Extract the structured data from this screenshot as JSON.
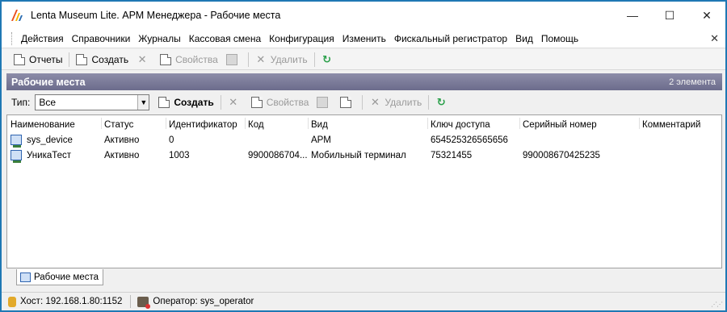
{
  "window": {
    "title": "Lenta Museum Lite. АРМ Менеджера - Рабочие места",
    "minimize": "—",
    "maximize": "☐",
    "close": "✕"
  },
  "menu": {
    "items": [
      "Действия",
      "Справочники",
      "Журналы",
      "Кассовая смена",
      "Конфигурация",
      "Изменить",
      "Фискальный регистратор",
      "Вид",
      "Помощь"
    ],
    "close": "✕"
  },
  "main_toolbar": {
    "reports": "Отчеты",
    "create": "Создать",
    "properties": "Свойства",
    "delete": "Удалить"
  },
  "panel": {
    "title": "Рабочие места",
    "count": "2 элемента",
    "type_label": "Тип:",
    "type_value": "Все",
    "create": "Создать",
    "properties": "Свойства",
    "delete": "Удалить"
  },
  "table": {
    "columns": [
      "Наименование",
      "Статус",
      "Идентификатор",
      "Код",
      "Вид",
      "Ключ доступа",
      "Серийный номер",
      "Комментарий"
    ],
    "rows": [
      [
        "sys_device",
        "Активно",
        "0",
        "",
        "АРМ",
        "654525326565656",
        "",
        ""
      ],
      [
        "УникаТест",
        "Активно",
        "1003",
        "9900086704...",
        "Мобильный терминал",
        "75321455",
        "990008670425235",
        ""
      ]
    ]
  },
  "tabs": {
    "active": "Рабочие места"
  },
  "status": {
    "host": "Хост: 192.168.1.80:1152",
    "operator": "Оператор: sys_operator"
  },
  "colors": {
    "window_border": "#1f78b4",
    "panel_header": "#6c6c8c",
    "refresh_icon": "#2aa04a"
  }
}
